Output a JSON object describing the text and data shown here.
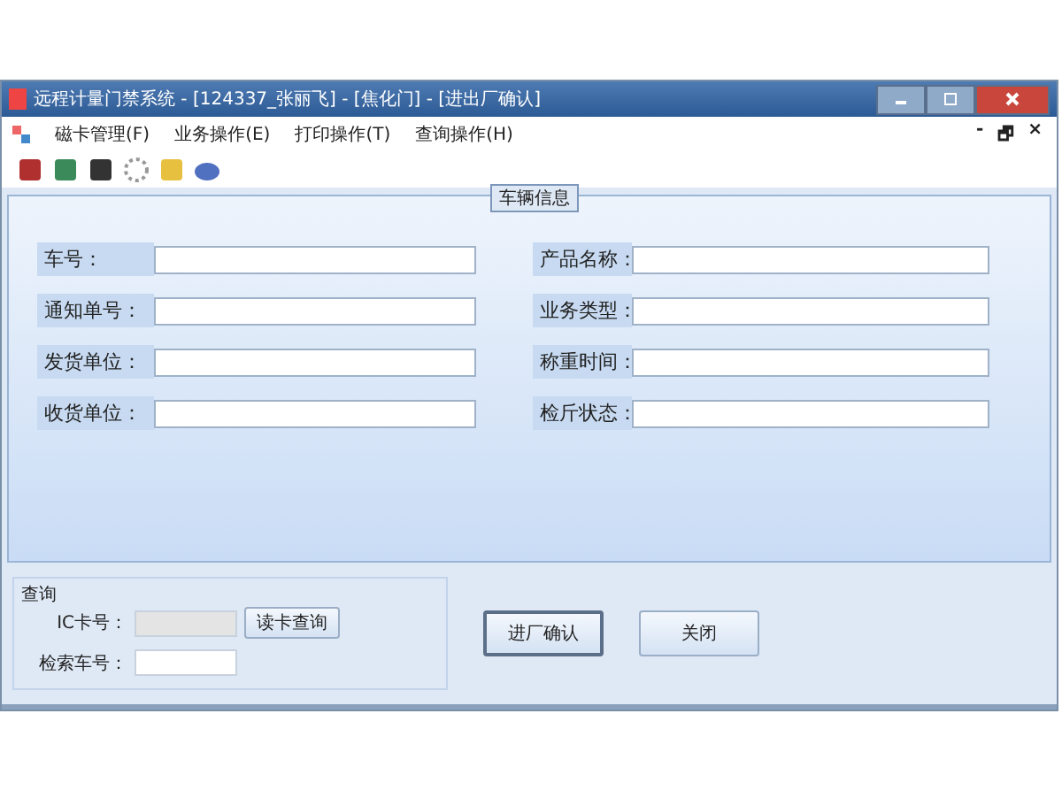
{
  "window": {
    "title": "远程计量门禁系统 - [124337_张丽飞] - [焦化门] - [进出厂确认]"
  },
  "menu": [
    {
      "label": "磁卡管理(F)"
    },
    {
      "label": "业务操作(E)"
    },
    {
      "label": "打印操作(T)"
    },
    {
      "label": "查询操作(H)"
    }
  ],
  "mdi_controls": [
    "-",
    "🗗",
    "×"
  ],
  "vehicle_info": {
    "title": "车辆信息",
    "left_fields": [
      {
        "label": "车号："
      },
      {
        "label": "通知单号："
      },
      {
        "label": "发货单位："
      },
      {
        "label": "收货单位："
      }
    ],
    "right_fields": [
      {
        "label": "产品名称："
      },
      {
        "label": "业务类型："
      },
      {
        "label": "称重时间："
      },
      {
        "label": "检斤状态："
      }
    ]
  },
  "query": {
    "title": "查询",
    "ic_card": {
      "label": "IC卡号：",
      "disabled": true
    },
    "read_button": "读卡查询",
    "plate": {
      "label": "检索车号：",
      "disabled": false
    }
  },
  "buttons": [
    {
      "label": "进厂确认",
      "selected": true
    },
    {
      "label": "关闭",
      "selected": false
    }
  ]
}
